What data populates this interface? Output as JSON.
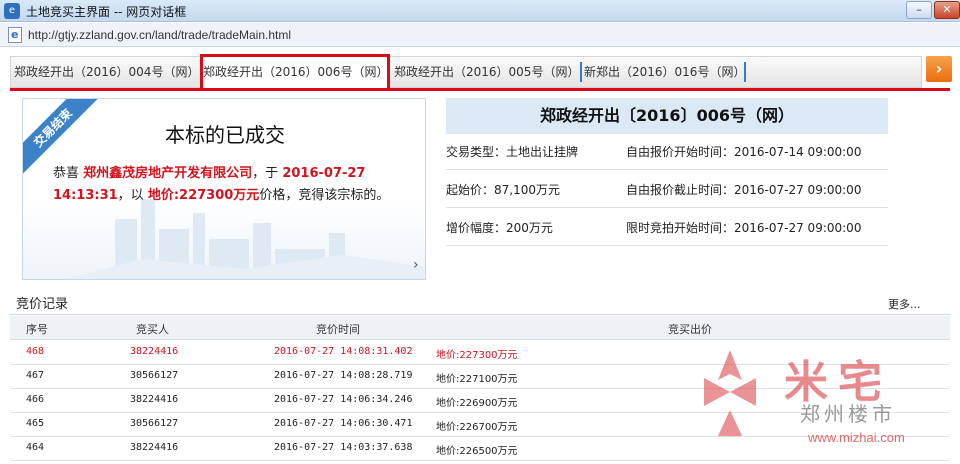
{
  "window": {
    "title": "土地竞买主界面 -- 网页对话框",
    "minimize": "–",
    "close": "✕"
  },
  "address": {
    "url": "http://gtjy.zzland.gov.cn/land/trade/tradeMain.html"
  },
  "tabs": [
    {
      "label": "郑政经开出（2016）004号（网）",
      "active": false
    },
    {
      "label": "郑政经开出（2016）006号（网）",
      "active": true
    },
    {
      "label": "郑政经开出（2016）005号（网）",
      "active": false
    },
    {
      "label": "新郑出（2016）016号（网）",
      "active": false
    }
  ],
  "tab_nav_icon": "chevron-right-icon",
  "result": {
    "ribbon": "交易结束",
    "title": "本标的已成交",
    "congrats": "恭喜",
    "company": "郑州鑫茂房地产开发有限公司",
    "at": "，于",
    "date": "2016-07-27",
    "time": "14:13:31",
    "with": "，以",
    "price": "地价:227300万元",
    "tail": "价格，竞得该宗标的。",
    "arrow": "›"
  },
  "info": {
    "title": "郑政经开出〔2016〕006号（网）",
    "rows": [
      {
        "left": "交易类型：土地出让挂牌",
        "right": "自由报价开始时间：2016-07-14 09:00:00"
      },
      {
        "left": "起始价：87,100万元",
        "right": "自由报价截止时间：2016-07-27 09:00:00"
      },
      {
        "left": "增价幅度：200万元",
        "right": "限时竞拍开始时间：2016-07-27 09:00:00"
      }
    ]
  },
  "records": {
    "title": "竞价记录",
    "more": "更多...",
    "columns": [
      "序号",
      "竞买人",
      "竞价时间",
      "竞买出价"
    ],
    "rows": [
      {
        "no": "468",
        "bidder": "38224416",
        "time": "2016-07-27 14:08:31.402",
        "price": "地价:227300万元",
        "highlight": true
      },
      {
        "no": "467",
        "bidder": "30566127",
        "time": "2016-07-27 14:08:28.719",
        "price": "地价:227100万元",
        "highlight": false
      },
      {
        "no": "466",
        "bidder": "38224416",
        "time": "2016-07-27 14:06:34.246",
        "price": "地价:226900万元",
        "highlight": false
      },
      {
        "no": "465",
        "bidder": "30566127",
        "time": "2016-07-27 14:06:30.471",
        "price": "地价:226700万元",
        "highlight": false
      },
      {
        "no": "464",
        "bidder": "38224416",
        "time": "2016-07-27 14:03:37.638",
        "price": "地价:226500万元",
        "highlight": false
      }
    ]
  },
  "watermark": {
    "brand": "米宅",
    "city": "郑州楼市",
    "url": "www.mizhai.com"
  },
  "colors": {
    "accent_red": "#d80c18",
    "tab_blue": "#2e7dd1",
    "header_blue": "#dbe9f7",
    "nav_orange": "#ea6d10"
  }
}
